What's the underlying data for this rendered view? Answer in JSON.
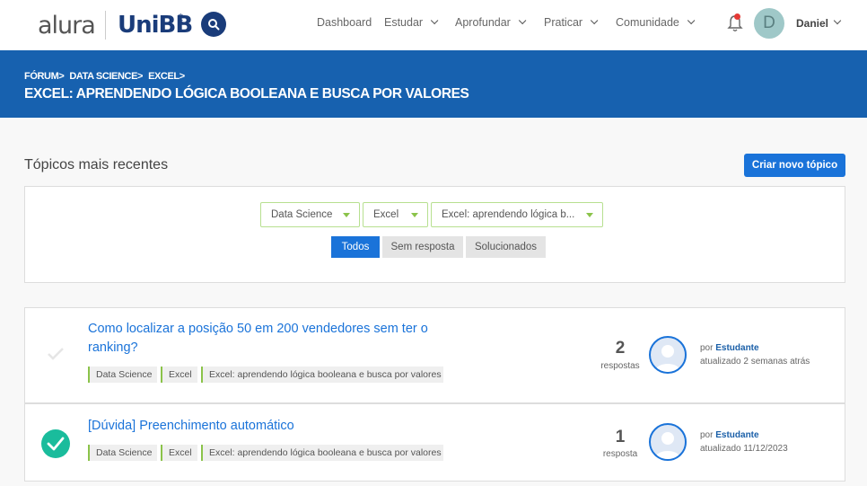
{
  "header": {
    "logo_alura": "alura",
    "logo_unibb": "UniBB",
    "nav": [
      {
        "label": "Dashboard",
        "has_menu": false
      },
      {
        "label": "Estudar",
        "has_menu": true
      },
      {
        "label": "Aprofundar",
        "has_menu": true
      },
      {
        "label": "Praticar",
        "has_menu": true
      },
      {
        "label": "Comunidade",
        "has_menu": true
      }
    ],
    "avatar_initial": "D",
    "user_name": "Daniel"
  },
  "banner": {
    "breadcrumbs": [
      "FÓRUM",
      "DATA SCIENCE",
      "EXCEL"
    ],
    "title": "EXCEL: APRENDENDO LÓGICA BOOLEANA E BUSCA POR VALORES"
  },
  "main": {
    "section_title": "Tópicos mais recentes",
    "create_button": "Criar novo tópico",
    "filters": {
      "category": "Data Science",
      "subcategory": "Excel",
      "course": "Excel: aprendendo lógica b..."
    },
    "tabs": [
      {
        "label": "Todos",
        "active": true
      },
      {
        "label": "Sem resposta",
        "active": false
      },
      {
        "label": "Solucionados",
        "active": false
      }
    ],
    "topics": [
      {
        "title": "Como localizar a posição 50 em 200 vendedores sem ter o ranking?",
        "solved": false,
        "tags": [
          "Data Science",
          "Excel",
          "Excel: aprendendo lógica booleana e busca por valores"
        ],
        "count": "2",
        "count_label": "respostas",
        "by_prefix": "por",
        "author": "Estudante",
        "updated": "atualizado 2 semanas atrás"
      },
      {
        "title": "[Dúvida] Preenchimento automático",
        "solved": true,
        "tags": [
          "Data Science",
          "Excel",
          "Excel: aprendendo lógica booleana e busca por valores"
        ],
        "count": "1",
        "count_label": "resposta",
        "by_prefix": "por",
        "author": "Estudante",
        "updated": "atualizado 11/12/2023"
      }
    ]
  },
  "colors": {
    "brand_blue": "#1761af",
    "button_blue": "#1a73d9",
    "tag_green": "#8bc34a",
    "solved_green": "#1abc9c"
  }
}
